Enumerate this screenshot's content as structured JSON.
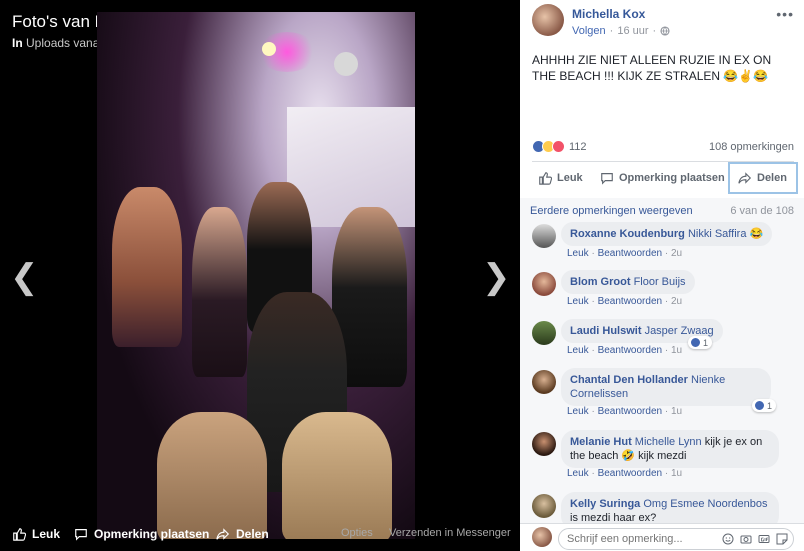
{
  "viewer": {
    "title": "Foto's van Michella Kox",
    "subtitle_in": "In",
    "subtitle": "Uploads vanaf je telefoon",
    "like_label": "Leuk",
    "comment_label": "Opmerking plaatsen",
    "share_label": "Delen",
    "options_label": "Opties",
    "messenger_label": "Verzenden in Messenger"
  },
  "post": {
    "author": "Michella Kox",
    "follow_label": "Volgen",
    "time": "16 uur",
    "more": "•••",
    "text": "AHHHH ZIE NIET ALLEEN RUZIE IN EX ON THE BEACH !!! KIJK ZE STRALEN 😂✌️😂",
    "reaction_count": "112",
    "comment_count": "108 opmerkingen",
    "like_label": "Leuk",
    "comment_label": "Opmerking plaatsen",
    "share_label": "Delen"
  },
  "comments": {
    "older_label": "Eerdere opmerkingen weergeven",
    "older_count": "6 van de 108",
    "like_label": "Leuk",
    "reply_label": "Beantwoorden",
    "items": [
      {
        "name": "Roxanne Koudenburg",
        "tag": "Nikki Saffira",
        "text": "😂",
        "time": "2u"
      },
      {
        "name": "Blom Groot",
        "tag": "Floor Buijs",
        "text": "",
        "time": "2u"
      },
      {
        "name": "Laudi Hulswit",
        "tag": "Jasper Zwaag",
        "text": "",
        "time": "1u",
        "reactions": "1"
      },
      {
        "name": "Chantal Den Hollander",
        "tag": "Nienke Cornelissen",
        "text": "",
        "time": "1u",
        "reactions": "1"
      },
      {
        "name": "Melanie Hut",
        "tag": "Michelle Lynn",
        "text": "kijk je ex on the beach 🤣 kijk mezdi",
        "time": "1u"
      },
      {
        "name": "Kelly Suringa",
        "tag": "Omg Esmee Noordenbos",
        "text": "is mezdi haar ex?",
        "time": ""
      }
    ]
  },
  "composer": {
    "placeholder": "Schrijf een opmerking..."
  },
  "colors": {
    "link": "#385898",
    "like_blue": "#4267b2",
    "haha_yellow": "#ffcc4d",
    "love_red": "#f25268"
  }
}
